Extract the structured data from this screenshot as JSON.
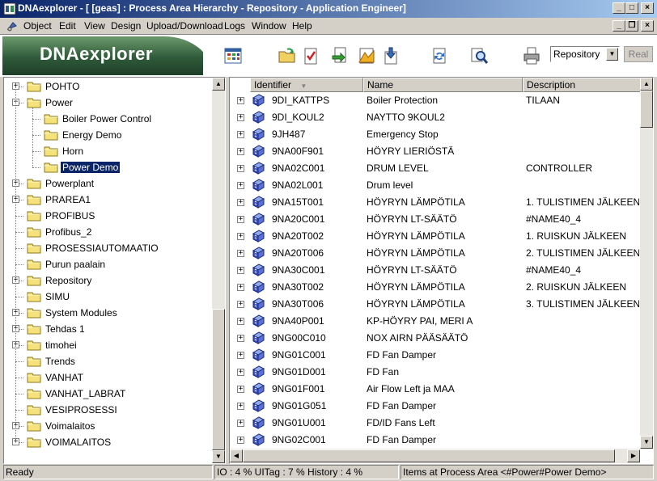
{
  "window": {
    "title": "DNAexplorer - [ [geas] : Process Area Hierarchy - Repository - Application Engineer]"
  },
  "menu": {
    "items": [
      "Object",
      "Edit",
      "View",
      "Design",
      "Upload/Download",
      "Logs",
      "Window",
      "Help"
    ]
  },
  "toolbar": {
    "logo": "DNAexplorer",
    "icons": [
      "grid-view-icon",
      "open-folder-icon",
      "checklist-icon",
      "refresh-doc-icon",
      "chart-doc-icon",
      "download-doc-icon",
      "sync-icon",
      "find-icon",
      "print-icon"
    ],
    "selector_value": "Repository",
    "real_button": "Real"
  },
  "tree": {
    "items": [
      {
        "label": "POHTO",
        "level": 0,
        "expander": "+"
      },
      {
        "label": "Power",
        "level": 0,
        "expander": "-"
      },
      {
        "label": "Boiler Power Control",
        "level": 1,
        "expander": ""
      },
      {
        "label": "Energy Demo",
        "level": 1,
        "expander": ""
      },
      {
        "label": "Horn",
        "level": 1,
        "expander": ""
      },
      {
        "label": "Power Demo",
        "level": 1,
        "expander": "",
        "selected": true
      },
      {
        "label": "Powerplant",
        "level": 0,
        "expander": "+"
      },
      {
        "label": "PRAREA1",
        "level": 0,
        "expander": "+"
      },
      {
        "label": "PROFIBUS",
        "level": 0,
        "expander": ""
      },
      {
        "label": "Profibus_2",
        "level": 0,
        "expander": ""
      },
      {
        "label": "PROSESSIAUTOMAATIO",
        "level": 0,
        "expander": ""
      },
      {
        "label": "Purun paalain",
        "level": 0,
        "expander": ""
      },
      {
        "label": "Repository",
        "level": 0,
        "expander": "+"
      },
      {
        "label": "SIMU",
        "level": 0,
        "expander": ""
      },
      {
        "label": "System Modules",
        "level": 0,
        "expander": "+"
      },
      {
        "label": "Tehdas 1",
        "level": 0,
        "expander": "+"
      },
      {
        "label": "timohei",
        "level": 0,
        "expander": "+"
      },
      {
        "label": "Trends",
        "level": 0,
        "expander": ""
      },
      {
        "label": "VANHAT",
        "level": 0,
        "expander": ""
      },
      {
        "label": "VANHAT_LABRAT",
        "level": 0,
        "expander": ""
      },
      {
        "label": "VESIPROSESSI",
        "level": 0,
        "expander": ""
      },
      {
        "label": "Voimalaitos",
        "level": 0,
        "expander": "+"
      },
      {
        "label": "VOIMALAITOS",
        "level": 0,
        "expander": "+"
      }
    ]
  },
  "list": {
    "columns": [
      "Identifier",
      "Name",
      "Description"
    ],
    "rows": [
      {
        "identifier": "9DI_KATTPS",
        "name": "Boiler Protection",
        "description": "TILAAN"
      },
      {
        "identifier": "9DI_KOUL2",
        "name": "NAYTTO 9KOUL2",
        "description": ""
      },
      {
        "identifier": "9JH487",
        "name": "Emergency Stop",
        "description": ""
      },
      {
        "identifier": "9NA00F901",
        "name": "HÖYRY LIERIÖSTÄ",
        "description": ""
      },
      {
        "identifier": "9NA02C001",
        "name": "DRUM LEVEL",
        "description": "CONTROLLER"
      },
      {
        "identifier": "9NA02L001",
        "name": "Drum level",
        "description": ""
      },
      {
        "identifier": "9NA15T001",
        "name": "HÖYRYN LÄMPÖTILA",
        "description": "1. TULISTIMEN JÄLKEEN"
      },
      {
        "identifier": "9NA20C001",
        "name": "HÖYRYN LT-SÄÄTÖ",
        "description": "#NAME40_4"
      },
      {
        "identifier": "9NA20T002",
        "name": "HÖYRYN LÄMPÖTILA",
        "description": "1. RUISKUN JÄLKEEN"
      },
      {
        "identifier": "9NA20T006",
        "name": "HÖYRYN LÄMPÖTILA",
        "description": "2. TULISTIMEN JÄLKEEN"
      },
      {
        "identifier": "9NA30C001",
        "name": "HÖYRYN LT-SÄÄTÖ",
        "description": "#NAME40_4"
      },
      {
        "identifier": "9NA30T002",
        "name": "HÖYRYN LÄMPÖTILA",
        "description": "2. RUISKUN JÄLKEEN"
      },
      {
        "identifier": "9NA30T006",
        "name": "HÖYRYN LÄMPÖTILA",
        "description": "3. TULISTIMEN JÄLKEEN"
      },
      {
        "identifier": "9NA40P001",
        "name": "KP-HÖYRY PAI, MERI A",
        "description": ""
      },
      {
        "identifier": "9NG00C010",
        "name": "NOX AIRN PÄÄSÄÄTÖ",
        "description": ""
      },
      {
        "identifier": "9NG01C001",
        "name": "FD Fan Damper",
        "description": ""
      },
      {
        "identifier": "9NG01D001",
        "name": "FD Fan",
        "description": ""
      },
      {
        "identifier": "9NG01F001",
        "name": "Air Flow Left ja MAA",
        "description": ""
      },
      {
        "identifier": "9NG01G051",
        "name": "FD Fan Damper",
        "description": ""
      },
      {
        "identifier": "9NG01U001",
        "name": "FD/ID Fans Left",
        "description": ""
      },
      {
        "identifier": "9NG02C001",
        "name": "FD Fan Damper",
        "description": ""
      }
    ]
  },
  "status": {
    "left": "Ready",
    "middle": "IO : 4 % UITag : 7 % History : 4 %",
    "right": "Items at Process Area <#Power#Power Demo>"
  }
}
